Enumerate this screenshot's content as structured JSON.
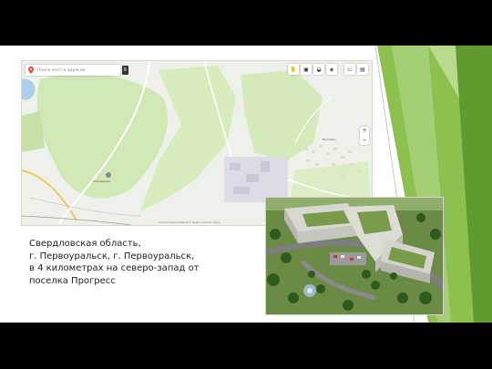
{
  "map": {
    "search_placeholder": "Поиск мест и адресов",
    "layer_button": "6",
    "toolbar_icons": [
      "hand-icon",
      "bus-icon",
      "car-icon",
      "layers-icon",
      "truck-icon",
      "calendar-icon"
    ],
    "zoom_in": "+",
    "zoom_out": "−",
    "footer": "Условия использования  © Яндекс  Создать карту",
    "labels": {
      "settlement": "Ключевская",
      "village": "Прогресс"
    }
  },
  "caption": {
    "line1": "Свердловская область,",
    "line2": "г. Первоуральск, г. Первоуральск,",
    "line3": "в 4 километрах на северо-запад от",
    "line4": "поселка Прогресс"
  },
  "colors": {
    "accent_green": "#7ab648",
    "dark_green": "#4e8a2c",
    "map_forest": "#cfe8b4",
    "map_bg": "#eef0ea"
  }
}
